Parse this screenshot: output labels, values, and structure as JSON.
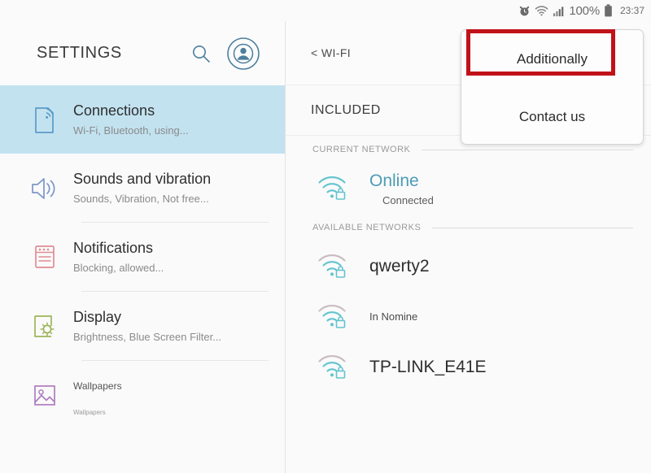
{
  "statusbar": {
    "icons": [
      "alarm-clock-icon",
      "wifi-icon",
      "signal-bars-icon",
      "battery-icon"
    ],
    "battery_text": "100%",
    "clock": "23:37"
  },
  "sidebar": {
    "title": "SETTINGS",
    "header_icons": [
      "search-icon",
      "account-circle-icon"
    ],
    "items": [
      {
        "label": "Connections",
        "sub": "Wi-Fi, Bluetooth, using...",
        "icon": "connections-icon",
        "icon_color": "#5b9bc8",
        "selected": true
      },
      {
        "label": "Sounds and vibration",
        "sub": "Sounds, Vibration, Not free...",
        "icon": "speaker-icon",
        "icon_color": "#7b96c7",
        "selected": false
      },
      {
        "label": "Notifications",
        "sub": "Blocking, allowed...",
        "icon": "notifications-icon",
        "icon_color": "#e08c92",
        "selected": false
      },
      {
        "label": "Display",
        "sub": "Brightness, Blue Screen Filter...",
        "icon": "display-brightness-icon",
        "icon_color": "#9ab558",
        "selected": false
      },
      {
        "label": "Wallpapers",
        "sub": "Wallpapers",
        "icon": "image-icon",
        "icon_color": "#b07cc0",
        "selected": false
      }
    ],
    "selected_bg": "#c2e2f0"
  },
  "panel": {
    "back_label": "< WI-FI",
    "included_label": "INCLUDED",
    "sections": [
      {
        "heading": "CURRENT NETWORK",
        "rows": [
          {
            "name": "Online",
            "sub": "Connected",
            "icon": "wifi-lock-icon",
            "current": true,
            "tiny": false
          }
        ]
      },
      {
        "heading": "AVAILABLE NETWORKS",
        "rows": [
          {
            "name": "qwerty2",
            "sub": "",
            "icon": "wifi-lock-icon",
            "current": false,
            "tiny": false
          },
          {
            "name": "In Nomine",
            "sub": "",
            "icon": "wifi-lock-icon",
            "current": false,
            "tiny": true
          },
          {
            "name": "TP-LINK_E41E",
            "sub": "",
            "icon": "wifi-lock-icon",
            "current": false,
            "tiny": false
          }
        ]
      }
    ],
    "current_color": "#4c9cb5",
    "wifi_icon_color": "#62c4cf"
  },
  "popup": {
    "items": [
      {
        "label": "Additionally",
        "highlighted": true
      },
      {
        "label": "Contact us",
        "highlighted": false
      }
    ],
    "highlight_color": "#c1121a"
  }
}
